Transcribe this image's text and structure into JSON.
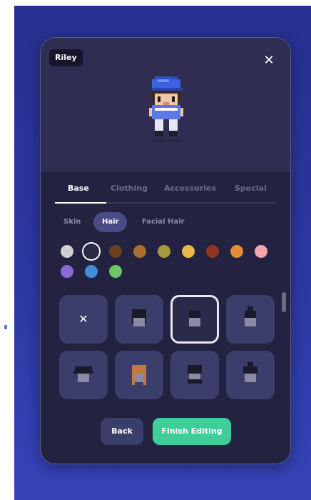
{
  "character": {
    "name": "Riley"
  },
  "header": {
    "close_icon": "close-icon"
  },
  "tabs": [
    {
      "label": "Base",
      "active": true
    },
    {
      "label": "Clothing",
      "active": false
    },
    {
      "label": "Accessories",
      "active": false
    },
    {
      "label": "Special",
      "active": false
    }
  ],
  "subtabs": [
    {
      "label": "Skin",
      "active": false
    },
    {
      "label": "Hair",
      "active": true
    },
    {
      "label": "Facial Hair",
      "active": false
    }
  ],
  "hair_colors": [
    {
      "color": "#cfcfcf",
      "selected": false
    },
    {
      "color": "#2b2b45",
      "selected": true
    },
    {
      "color": "#6b3f20",
      "selected": false
    },
    {
      "color": "#a86d31",
      "selected": false
    },
    {
      "color": "#a6983f",
      "selected": false
    },
    {
      "color": "#e8b84b",
      "selected": false
    },
    {
      "color": "#8e3622",
      "selected": false
    },
    {
      "color": "#e58a35",
      "selected": false
    },
    {
      "color": "#f3a4ad",
      "selected": false
    },
    {
      "color": "#8a6ad7",
      "selected": false
    },
    {
      "color": "#3f8fdc",
      "selected": false
    },
    {
      "color": "#6cc369",
      "selected": false
    }
  ],
  "hair_styles": [
    {
      "icon": "none-x-icon",
      "selected": false
    },
    {
      "icon": "hair-style-icon",
      "selected": false
    },
    {
      "icon": "hair-style-icon",
      "selected": true
    },
    {
      "icon": "hair-style-icon",
      "selected": false
    },
    {
      "icon": "hair-style-icon",
      "selected": false
    },
    {
      "icon": "hair-style-icon",
      "selected": false
    },
    {
      "icon": "hair-style-icon",
      "selected": false
    },
    {
      "icon": "hair-style-icon",
      "selected": false
    }
  ],
  "actions": {
    "back_label": "Back",
    "finish_label": "Finish Editing"
  },
  "colors": {
    "accent_green": "#3fcd98",
    "panel_bg": "#232240",
    "tile_bg": "#3b3d6a"
  }
}
